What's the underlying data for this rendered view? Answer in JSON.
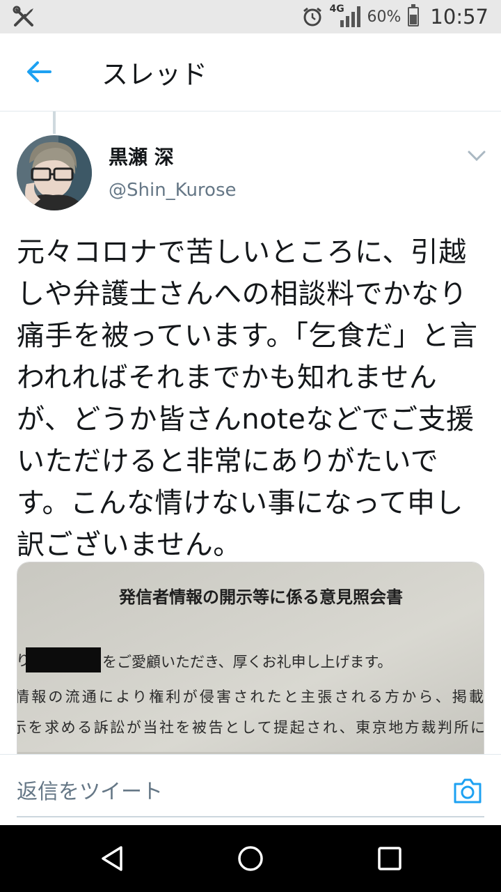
{
  "status_bar": {
    "network": "4G",
    "battery_percent": "60%",
    "battery_level": 0.6,
    "time": "10:57",
    "icons": [
      "tools-icon",
      "alarm-icon",
      "signal-icon",
      "battery-icon"
    ]
  },
  "header": {
    "title": "スレッド",
    "back_icon": "arrow-left-icon"
  },
  "tweet": {
    "author_name": "黒瀬 深",
    "author_handle": "@Shin_Kurose",
    "text": "元々コロナで苦しいところに、引越しや弁護士さんへの相談料でかなり痛手を被っています。「乞食だ」と言われればそれまでかも知れませんが、どうか皆さんnoteなどでご支援いただけると非常にありがたいです。こんな情けない事になって申し訳ございません。",
    "media": {
      "doc_title": "発信者情報の開示等に係る意見照会書",
      "line1": "をご愛顧いただき、厚くお礼申し上げます。",
      "line2": "情報の流通により権利が侵害されたと主張される方から、掲載",
      "line3": "示を求める訴訟が当社を被告として提起され、東京地方裁判所に"
    }
  },
  "reply": {
    "placeholder": "返信をツイート"
  },
  "colors": {
    "accent": "#1da1f2",
    "text": "#14171a",
    "secondary": "#657786"
  }
}
